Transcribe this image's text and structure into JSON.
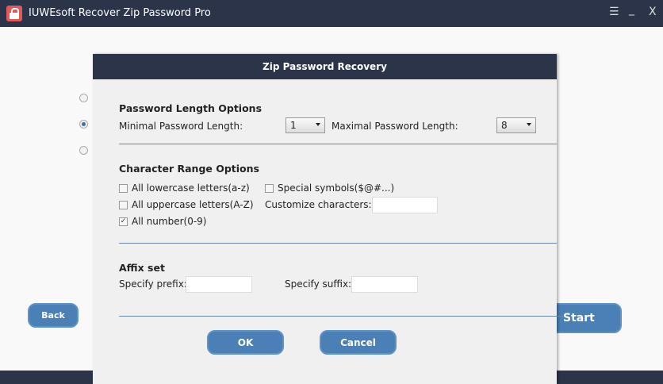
{
  "window": {
    "title": "IUWEsoft Recover Zip Password Pro",
    "menu_icon": "menu-icon",
    "minimize_icon": "minimize-icon",
    "close_icon": "close-icon",
    "menu": "☰",
    "minimize": "_",
    "close": "X"
  },
  "background": {
    "back_label": "Back",
    "start_label": "Start",
    "radio_selected_index": 1
  },
  "dialog": {
    "title": "Zip Password Recovery",
    "length": {
      "heading": "Password Length Options",
      "min_label": "Minimal Password Length:",
      "min_value": "1",
      "max_label": "Maximal Password Length:",
      "max_value": "8"
    },
    "charset": {
      "heading": "Character Range Options",
      "lowercase": {
        "label": "All lowercase letters(a-z)",
        "checked": false
      },
      "uppercase": {
        "label": "All uppercase letters(A-Z)",
        "checked": false
      },
      "numbers": {
        "label": "All number(0-9)",
        "checked": true
      },
      "special": {
        "label": "Special symbols($@#...)",
        "checked": false
      },
      "custom_label": "Customize characters:",
      "custom_value": ""
    },
    "affix": {
      "heading": "Affix set",
      "prefix_label": "Specify prefix:",
      "prefix_value": "",
      "suffix_label": "Specify suffix:",
      "suffix_value": ""
    },
    "ok_label": "OK",
    "cancel_label": "Cancel"
  }
}
